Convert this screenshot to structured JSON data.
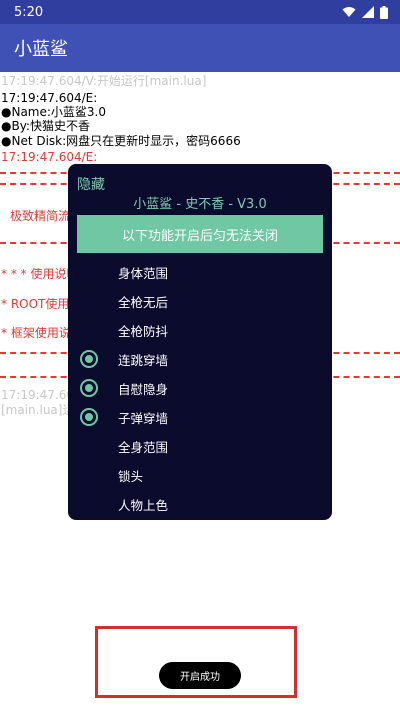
{
  "status_bar": {
    "time": "5:20",
    "icons": [
      "wifi-icon",
      "signal-icon",
      "battery-icon"
    ]
  },
  "app_bar": {
    "title": "小蓝鲨"
  },
  "log": {
    "line1": "17:19:47.604/V:开始运行[main.lua]",
    "line2": "17:19:47.604/E:",
    "line3": "●Name:小蓝鲨3.0",
    "line4": "●By:快猫史不香",
    "line5": "●Net Disk:网盘只在更新时显示，密码6666",
    "line6": "17:19:47.604/E:",
    "line7": "极致精简流",
    "line8": "* * * 使用说明",
    "line9": "* ROOT使用",
    "line10": "* 框架使用说",
    "line11": "17:19:47.60",
    "line12": "[main.lua]运"
  },
  "dialog": {
    "hide_label": "隐藏",
    "title": "小蓝鲨 - 史不香 - V3.0",
    "banner": "以下功能开启后匀无法关闭",
    "options": [
      {
        "label": "身体范围",
        "checked": false
      },
      {
        "label": "全枪无后",
        "checked": false
      },
      {
        "label": "全枪防抖",
        "checked": false
      },
      {
        "label": "连跳穿墙",
        "checked": true
      },
      {
        "label": "自慰隐身",
        "checked": true
      },
      {
        "label": "子弹穿墙",
        "checked": true
      },
      {
        "label": "全身范围",
        "checked": false
      },
      {
        "label": "锁头",
        "checked": false
      },
      {
        "label": "人物上色",
        "checked": false
      }
    ]
  },
  "toast": {
    "text": "开启成功"
  },
  "colors": {
    "status_bar": "#303f9f",
    "app_bar": "#3f51b5",
    "dialog_bg": "#0b0b2e",
    "accent": "#6fc7a3",
    "log_red": "#e53935",
    "highlight": "#d32f2f"
  }
}
